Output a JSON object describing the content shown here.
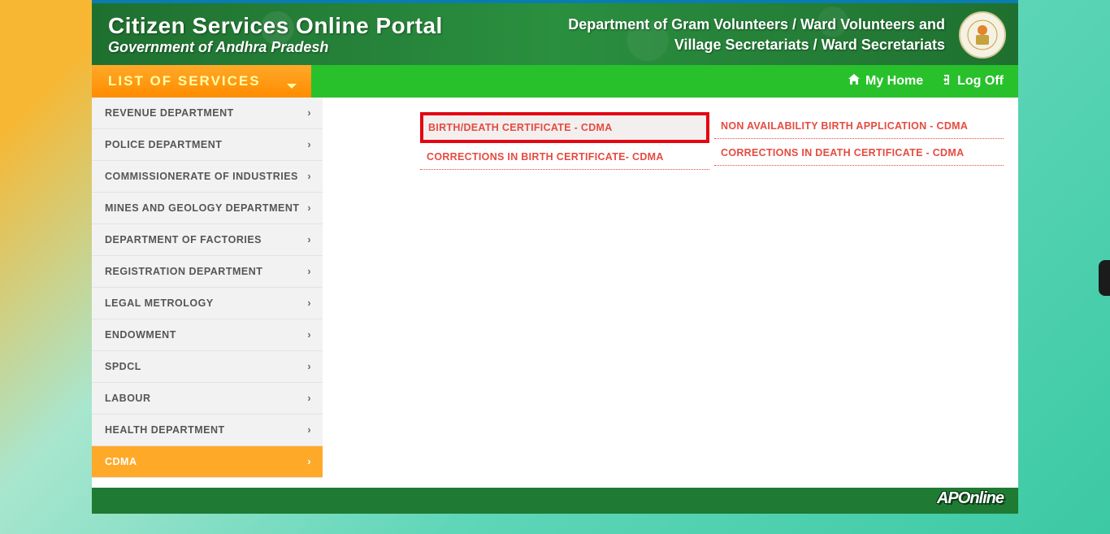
{
  "header": {
    "title": "Citizen Services Online Portal",
    "subtitle": "Government of Andhra Pradesh",
    "dept_line1": "Department of Gram Volunteers / Ward Volunteers and",
    "dept_line2": "Village Secretariats / Ward Secretariats"
  },
  "topbar": {
    "list_label": "LIST OF SERVICES",
    "my_home": "My Home",
    "log_off": "Log Off"
  },
  "sidebar": {
    "items": [
      {
        "label": "REVENUE DEPARTMENT"
      },
      {
        "label": "POLICE DEPARTMENT"
      },
      {
        "label": "COMMISSIONERATE OF INDUSTRIES"
      },
      {
        "label": "MINES AND GEOLOGY DEPARTMENT"
      },
      {
        "label": "DEPARTMENT OF FACTORIES"
      },
      {
        "label": "REGISTRATION DEPARTMENT"
      },
      {
        "label": "LEGAL METROLOGY"
      },
      {
        "label": "ENDOWMENT"
      },
      {
        "label": "SPDCL"
      },
      {
        "label": "LABOUR"
      },
      {
        "label": "HEALTH DEPARTMENT"
      },
      {
        "label": "CDMA"
      }
    ]
  },
  "services": {
    "col1": [
      "BIRTH/DEATH CERTIFICATE - CDMA",
      "CORRECTIONS IN BIRTH CERTIFICATE- CDMA"
    ],
    "col2": [
      "NON AVAILABILITY BIRTH APPLICATION - CDMA",
      "CORRECTIONS IN DEATH CERTIFICATE - CDMA"
    ]
  },
  "footer": {
    "brand": "APOnline"
  }
}
